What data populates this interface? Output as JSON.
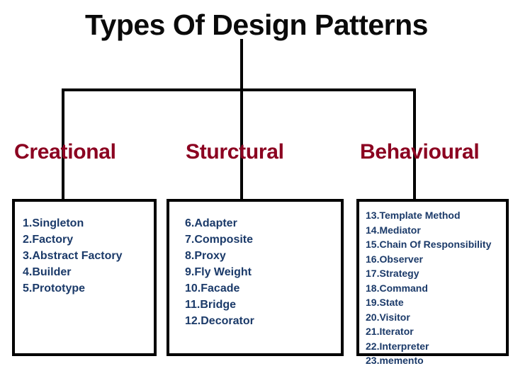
{
  "title": "Types Of Design Patterns",
  "colors": {
    "title_text": "#0a0a0a",
    "category_header": "#8B0020",
    "item_text": "#1B3A69",
    "connector_line": "#000000",
    "box_border": "#000000",
    "background": "#ffffff"
  },
  "categories": [
    {
      "name": "Creational",
      "items": [
        "1.Singleton",
        "2.Factory",
        "3.Abstract Factory",
        "4.Builder",
        "5.Prototype"
      ]
    },
    {
      "name": "Sturctural",
      "items": [
        "6.Adapter",
        "7.Composite",
        "8.Proxy",
        "9.Fly Weight",
        "10.Facade",
        "11.Bridge",
        "12.Decorator"
      ]
    },
    {
      "name": "Behavioural",
      "items": [
        "13.Template Method",
        "14.Mediator",
        "15.Chain Of Responsibility",
        "16.Observer",
        "17.Strategy",
        "18.Command",
        "19.State",
        "20.Visitor",
        "21.Iterator",
        "22.Interpreter",
        "23.memento"
      ]
    }
  ]
}
